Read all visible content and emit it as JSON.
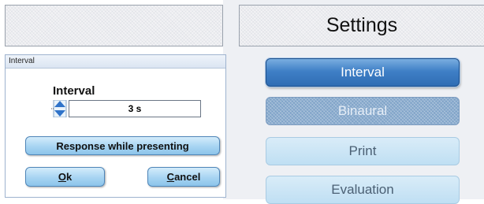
{
  "header": {
    "title": "Settings"
  },
  "dialog": {
    "title": "Interval",
    "field_label": "Interval",
    "field_value": "3 s",
    "response_button": "Response while presenting",
    "ok_button": "Ok",
    "cancel_button": "Cancel"
  },
  "side_menu": {
    "items": [
      {
        "label": "Interval",
        "state": "selected"
      },
      {
        "label": "Binaural",
        "state": "disabled"
      },
      {
        "label": "Print",
        "state": "normal"
      },
      {
        "label": "Evaluation",
        "state": "normal"
      }
    ]
  },
  "icons": {
    "spinner": "up-down-spinner-icon"
  },
  "colors": {
    "accent_selected": "#3f7fc6",
    "button_light": "#a7d4f2",
    "dialog_border": "#9eb3cf"
  }
}
